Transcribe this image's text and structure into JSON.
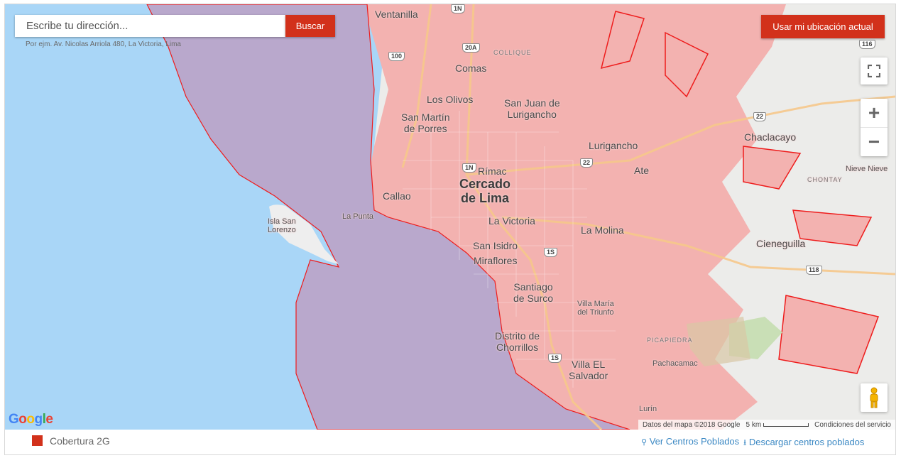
{
  "search": {
    "placeholder": "Escribe tu dirección...",
    "button": "Buscar",
    "hint": "Por ejm. Av. Nicolas Arriola 480, La Victoria, Lima"
  },
  "location_button": "Usar mi ubicación actual",
  "controls": {
    "fullscreen_icon": "fullscreen-icon",
    "zoom_in": "+",
    "zoom_out": "−",
    "pegman_icon": "pegman-icon"
  },
  "map": {
    "colors": {
      "sea": "#a9d6f7",
      "coverage": "#f3b2b0",
      "coverage_border": "#ee1c1c",
      "overlap_sea": "#b9a8cc",
      "land": "#eeeeee",
      "park": "#c9dfb6"
    },
    "places": {
      "ventanilla": "Ventanilla",
      "comas": "Comas",
      "collique": "COLLIQUE",
      "los_olivos": "Los Olivos",
      "san_martin": "San Martín\nde Porres",
      "sjl": "San Juan de\nLurigancho",
      "lurigancho": "Lurigancho",
      "chaclacayo": "Chaclacayo",
      "chontay": "CHONTAY",
      "nieve": "Nieve Nieve",
      "rimac": "Rímac",
      "cercado": "Cercado\nde Lima",
      "callao": "Callao",
      "ate": "Ate",
      "la_punta": "La Punta",
      "isla": "Isla San\nLorenzo",
      "la_victoria": "La Victoria",
      "la_molina": "La Molina",
      "san_isidro": "San Isidro",
      "miraflores": "Miraflores",
      "cieneguilla": "Cieneguilla",
      "surco": "Santiago\nde Surco",
      "vmt": "Villa María\ndel Triunfo",
      "picapiedra": "PICAPIEDRA",
      "chorrillos": "Distrito de\nChorrillos",
      "pachacamac": "Pachacamac",
      "ves": "Villa EL\nSalvador",
      "lurin": "Lurín"
    },
    "shields": {
      "s1n_top": "1N",
      "s100": "100",
      "s20a": "20A",
      "s116": "116",
      "s22a": "22",
      "s1n": "1N",
      "s22b": "22",
      "s1s": "1S",
      "s118": "118",
      "s1s_b": "1S"
    },
    "google_logo": "Google",
    "attribution": {
      "data": "Datos del mapa ©2018 Google",
      "scale": "5 km",
      "terms": "Condiciones del servicio"
    }
  },
  "legend": {
    "label": "Cobertura 2G",
    "color": "#d2311b"
  },
  "links": {
    "centros": "Ver Centros Poblados",
    "descargar": "Descargar centros poblados"
  }
}
